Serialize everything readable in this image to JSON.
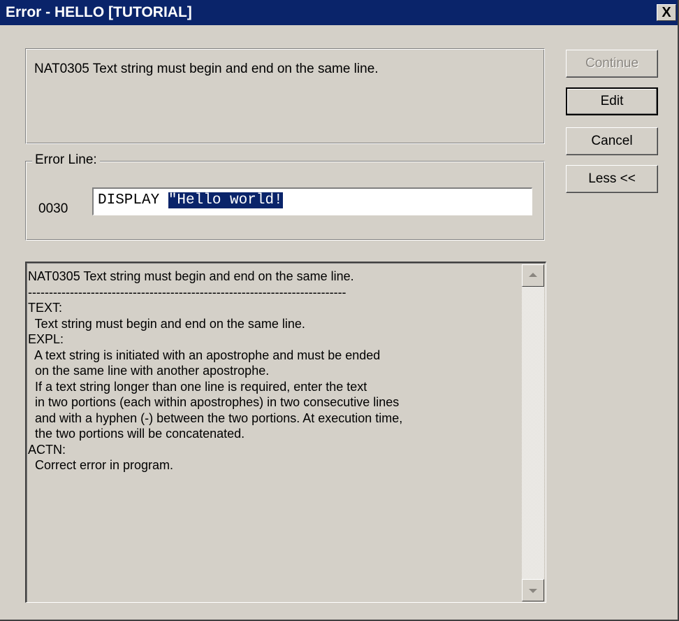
{
  "window": {
    "title": "Error - HELLO [TUTORIAL]",
    "close_glyph": "X"
  },
  "message": {
    "text": "NAT0305 Text string must begin and end on the same line."
  },
  "error_line": {
    "group_label": "Error Line:",
    "line_number": "0030",
    "code_prefix": "DISPLAY ",
    "code_selected": "\"Hello world!"
  },
  "buttons": {
    "continue": "Continue",
    "edit": "Edit",
    "cancel": "Cancel",
    "less": "Less <<"
  },
  "details": {
    "text": "NAT0305 Text string must begin and end on the same line.\n----------------------------------------------------------------------------\nTEXT:\n  Text string must begin and end on the same line.\nEXPL:\n  A text string is initiated with an apostrophe and must be ended\n  on the same line with another apostrophe.\n  If a text string longer than one line is required, enter the text\n  in two portions (each within apostrophes) in two consecutive lines\n  and with a hyphen (-) between the two portions. At execution time,\n  the two portions will be concatenated.\nACTN:\n  Correct error in program."
  },
  "colors": {
    "title_bar": "#0a246a",
    "dialog_face": "#d4d0c8",
    "selection": "#0a246a"
  }
}
